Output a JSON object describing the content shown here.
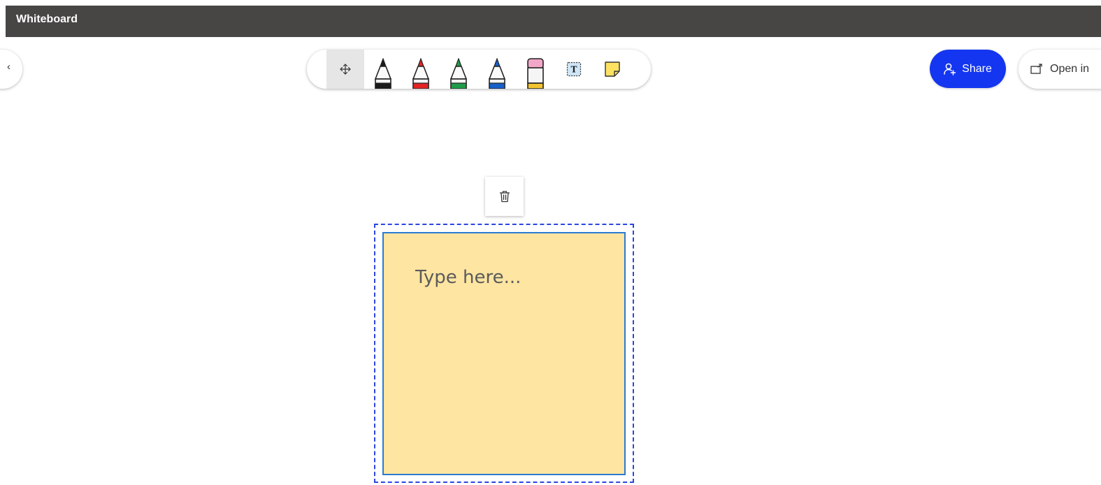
{
  "app": {
    "title": "Whiteboard"
  },
  "toolbar": {
    "tools": [
      {
        "name": "move",
        "icon": "move-arrows-icon",
        "selected": true
      },
      {
        "name": "black-pen",
        "icon": "pen-icon",
        "color": "#1a1a1a"
      },
      {
        "name": "red-pen",
        "icon": "pen-icon",
        "color": "#e22424"
      },
      {
        "name": "green-pen",
        "icon": "pen-icon",
        "color": "#1f9c4a"
      },
      {
        "name": "blue-pen",
        "icon": "pen-icon",
        "color": "#1760c9"
      },
      {
        "name": "eraser",
        "icon": "eraser-icon",
        "colors": [
          "#f2a7c8",
          "#f4c430"
        ]
      },
      {
        "name": "text",
        "icon": "text-box-icon",
        "glyph": "T"
      },
      {
        "name": "sticky-note",
        "icon": "sticky-note-icon",
        "color": "#fde262"
      }
    ]
  },
  "header": {
    "collapse_glyph": "‹",
    "share_label": "Share",
    "share_color": "#1436f0",
    "open_in_label": "Open in"
  },
  "canvas": {
    "delete_icon": "trash-icon",
    "sticky": {
      "placeholder": "Type here...",
      "fill": "#fee5a1",
      "border": "#2b7ad2",
      "selection_color": "#2b45e3"
    }
  }
}
